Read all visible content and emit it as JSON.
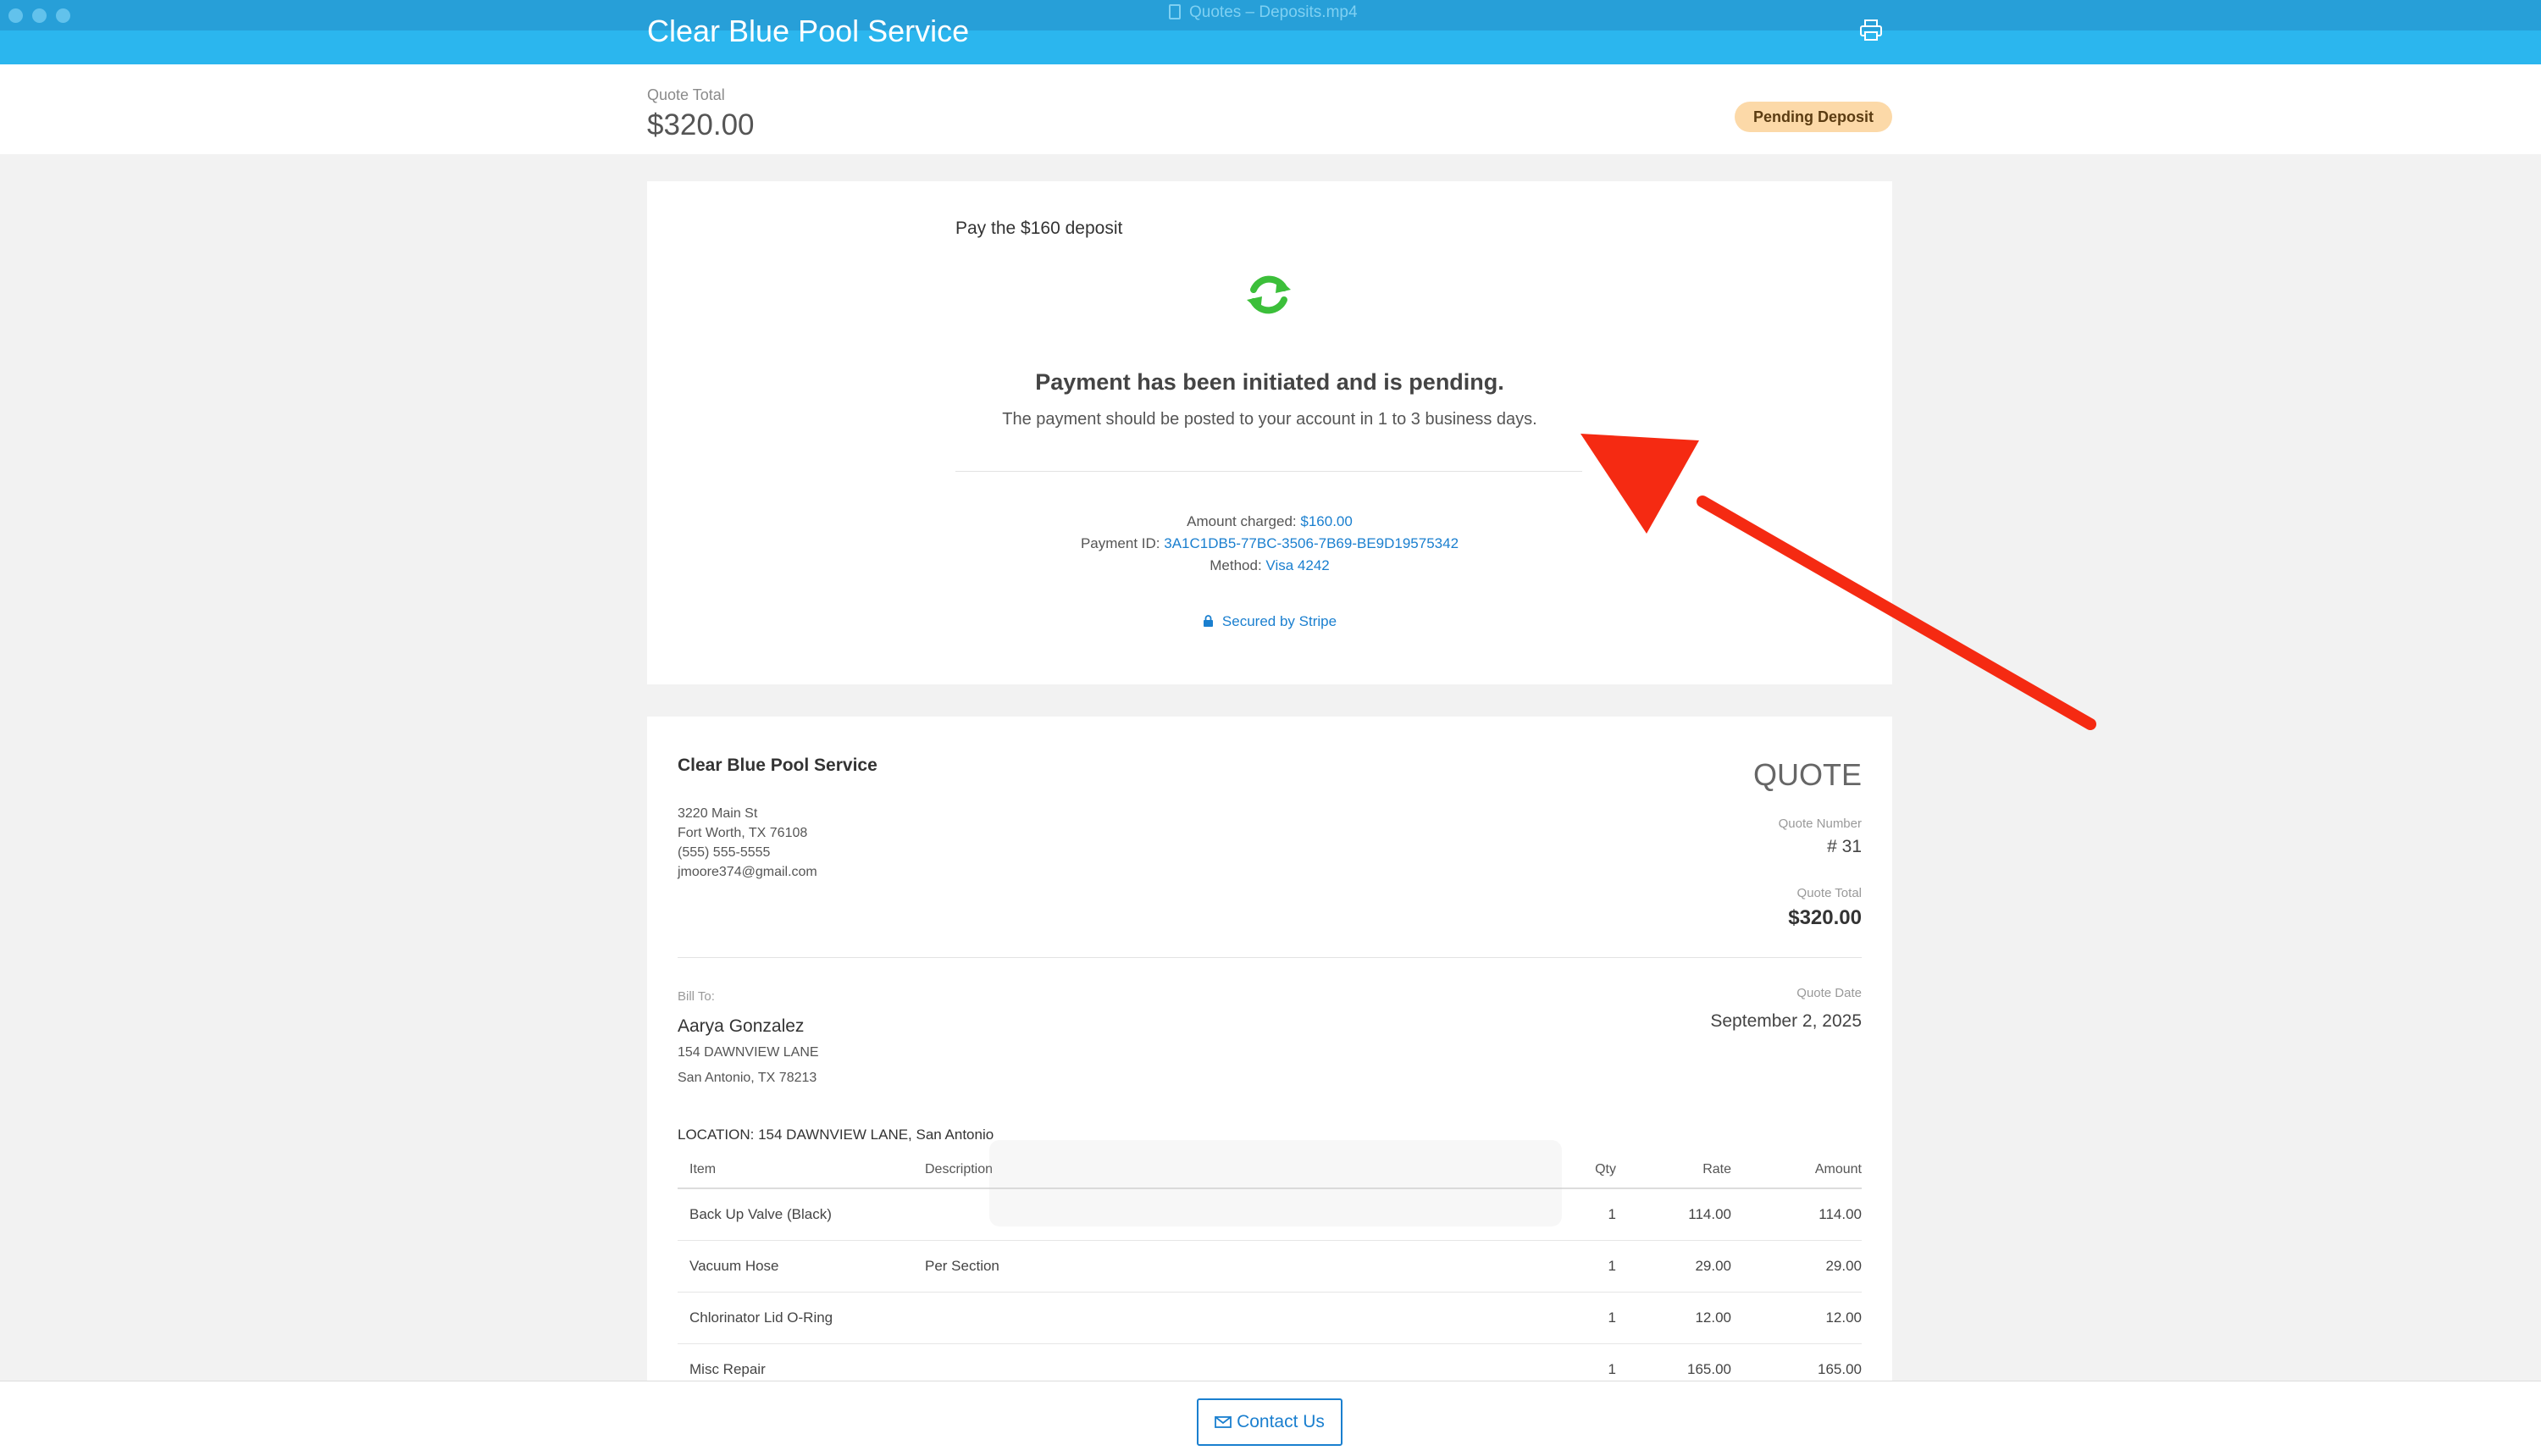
{
  "window": {
    "video_title": "Quotes – Deposits.mp4"
  },
  "header": {
    "brand": "Clear Blue Pool Service",
    "print_icon": "printer-icon"
  },
  "summary": {
    "label": "Quote Total",
    "total": "$320.00",
    "status": "Pending Deposit"
  },
  "payment": {
    "heading": "Pay the $160 deposit",
    "icon": "sync-icon",
    "title": "Payment has been initiated and is pending.",
    "subtitle": "The payment should be posted to your account in 1 to 3 business days.",
    "amount_label": "Amount charged:",
    "amount_value": "$160.00",
    "payment_id_label": "Payment ID:",
    "payment_id_value": "3A1C1DB5-77BC-3506-7B69-BE9D19575342",
    "method_label": "Method:",
    "method_value": "Visa 4242",
    "secured": "Secured by Stripe"
  },
  "quote": {
    "company": "Clear Blue Pool Service",
    "address": [
      "3220 Main St",
      "Fort Worth, TX 76108",
      "(555) 555-5555",
      "jmoore374@gmail.com"
    ],
    "doc_title": "QUOTE",
    "number_label": "Quote Number",
    "number_value": "# 31",
    "total_label": "Quote Total",
    "total_value": "$320.00",
    "bill_to_label": "Bill To:",
    "bill_to_name": "Aarya Gonzalez",
    "bill_to_lines": [
      "154 DAWNVIEW LANE",
      "San Antonio, TX 78213"
    ],
    "date_label": "Quote Date",
    "date_value": "September 2, 2025",
    "location": "LOCATION: 154 DAWNVIEW LANE, San Antonio",
    "columns": {
      "item": "Item",
      "description": "Description",
      "qty": "Qty",
      "rate": "Rate",
      "amount": "Amount"
    },
    "rows": [
      {
        "item": "Back Up Valve (Black)",
        "description": "",
        "qty": "1",
        "rate": "114.00",
        "amount": "114.00"
      },
      {
        "item": "Vacuum Hose",
        "description": "Per Section",
        "qty": "1",
        "rate": "29.00",
        "amount": "29.00"
      },
      {
        "item": "Chlorinator Lid O-Ring",
        "description": "",
        "qty": "1",
        "rate": "12.00",
        "amount": "12.00"
      },
      {
        "item": "Misc Repair",
        "description": "",
        "qty": "1",
        "rate": "165.00",
        "amount": "165.00"
      }
    ]
  },
  "footer": {
    "contact": "Contact Us"
  },
  "colors": {
    "header": "#2bb6ee",
    "accent": "#1a7fcf",
    "badge": "#fcd9a8",
    "sync": "#3cbf3a",
    "arrow": "#f52a12"
  }
}
